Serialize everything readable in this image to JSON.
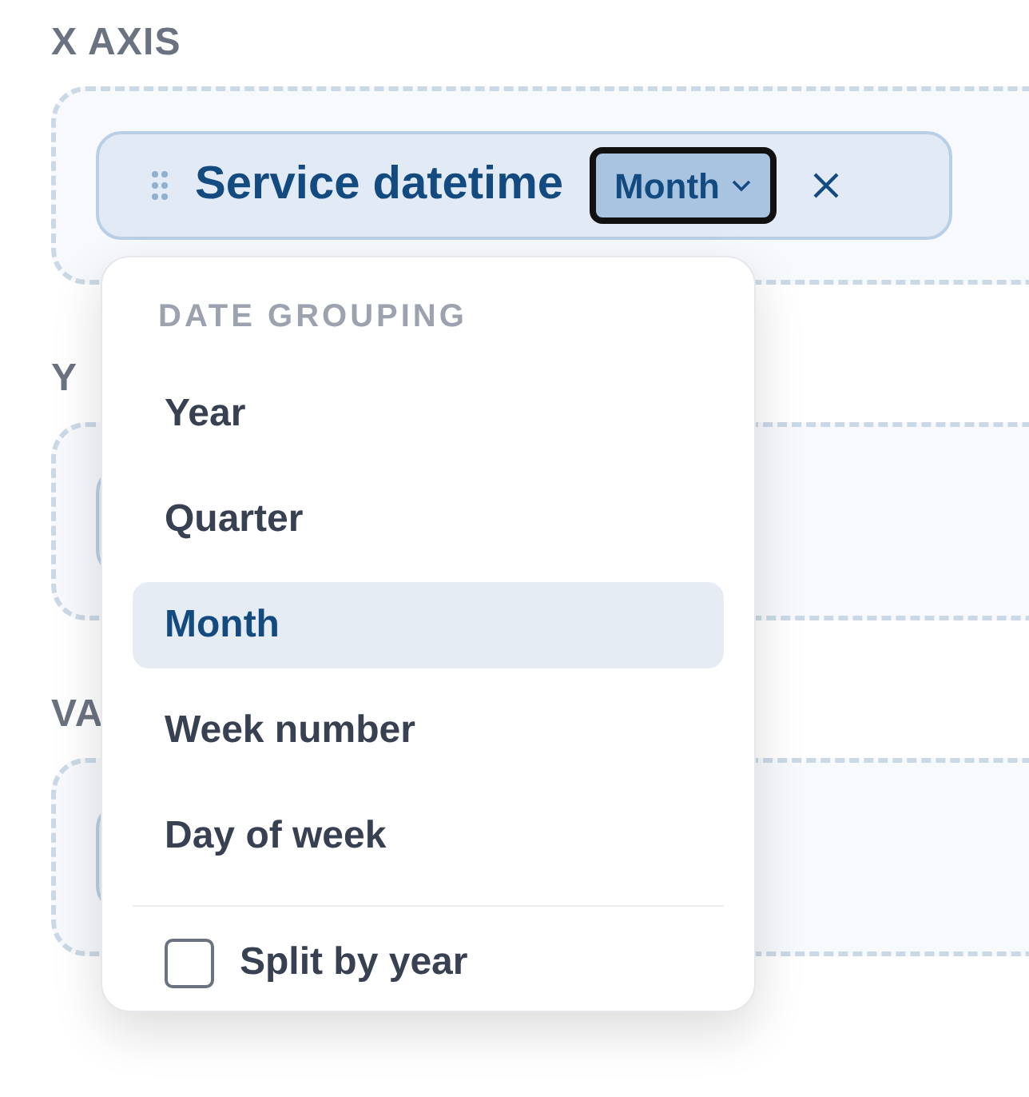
{
  "sections": [
    {
      "label": "X AXIS",
      "chip": {
        "name": "Service datetime",
        "grouping": "Month"
      }
    },
    {
      "label": "Y"
    },
    {
      "label": "VA"
    }
  ],
  "menu": {
    "header": "DATE GROUPING",
    "options": [
      {
        "label": "Year",
        "selected": false
      },
      {
        "label": "Quarter",
        "selected": false
      },
      {
        "label": "Month",
        "selected": true
      },
      {
        "label": "Week number",
        "selected": false
      },
      {
        "label": "Day of week",
        "selected": false
      }
    ],
    "split_by_year": {
      "label": "Split by year",
      "checked": false
    }
  }
}
